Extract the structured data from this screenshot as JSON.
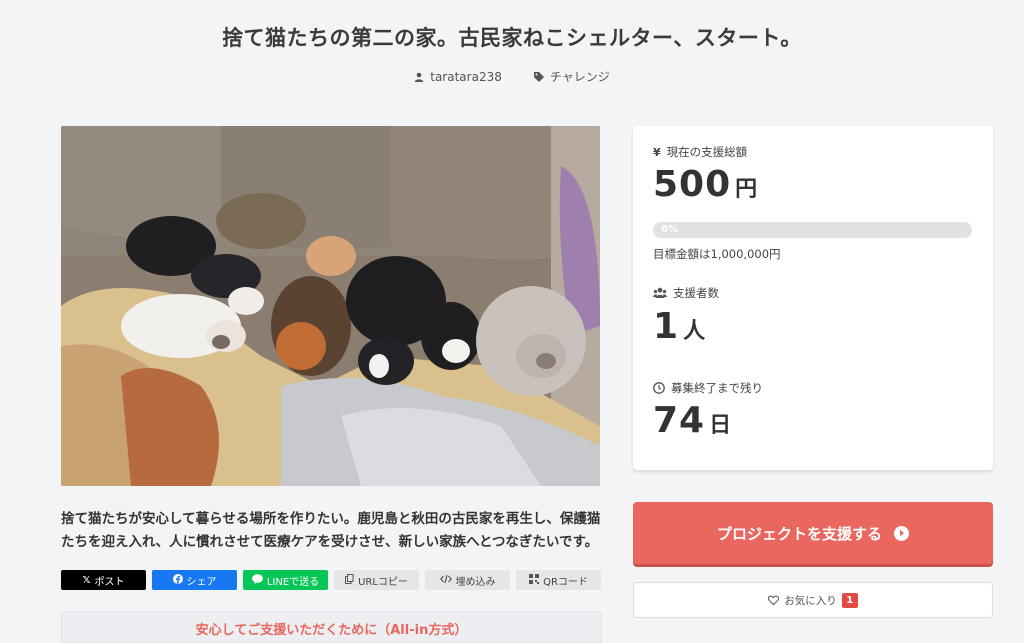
{
  "project": {
    "title": "捨て猫たちの第二の家。古民家ねこシェルター、スタート。",
    "author": "taratara238",
    "category": "チャレンジ",
    "description": "捨て猫たちが安心して暮らせる場所を作りたい。鹿児島と秋田の古民家を再生し、保護猫たちを迎え入れ、人に慣れさせて医療ケアを受けさせ、新しい家族へとつなぎたいです。"
  },
  "share": {
    "x_label": "ポスト",
    "facebook_label": "シェア",
    "line_label": "LINEで送る",
    "url_label": "URLコピー",
    "embed_label": "埋め込み",
    "qr_label": "QRコード"
  },
  "notice": {
    "text": "安心してご支援いただくために（All-in方式）"
  },
  "stats": {
    "total_label": "現在の支援総額",
    "total_amount": "500",
    "total_unit": "円",
    "progress_percent": 0,
    "progress_label": "0%",
    "goal_text": "目標金額は1,000,000円",
    "supporters_label": "支援者数",
    "supporters_count": "1",
    "supporters_unit": "人",
    "remaining_label": "募集終了まで残り",
    "remaining_days": "74",
    "remaining_unit": "日"
  },
  "actions": {
    "support_label": "プロジェクトを支援する",
    "favorite_label": "お気に入り",
    "favorite_count": "1"
  },
  "colors": {
    "accent": "#e9675f",
    "background": "#f3f4f6",
    "x": "#000000",
    "facebook": "#1877f2",
    "line": "#06c755"
  },
  "icons": {
    "author": "user-icon",
    "category": "tag-icon",
    "total": "yen-icon",
    "supporters": "users-icon",
    "remaining": "clock-icon",
    "support_arrow": "arrow-circle-right-icon",
    "favorite": "heart-icon"
  }
}
